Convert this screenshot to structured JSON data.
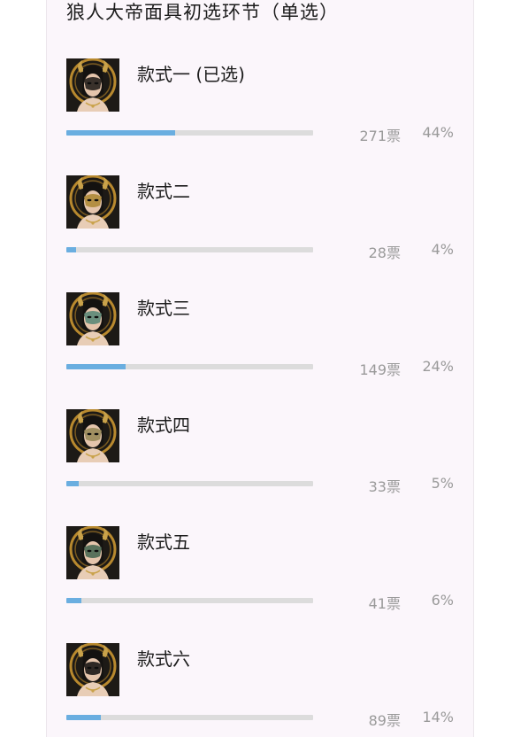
{
  "poll": {
    "title": "狼人大帝面具初选环节（单选）",
    "accent_color": "#6aaee0",
    "options": [
      {
        "label": "款式一 (已选)",
        "votes": "271票",
        "percent": "44%",
        "fill": 0.44,
        "mask_color": "#2a2420",
        "selected": true
      },
      {
        "label": "款式二",
        "votes": "28票",
        "percent": "4%",
        "fill": 0.04,
        "mask_color": "#b08a3a",
        "selected": false
      },
      {
        "label": "款式三",
        "votes": "149票",
        "percent": "24%",
        "fill": 0.24,
        "mask_color": "#5f8a78",
        "selected": false
      },
      {
        "label": "款式四",
        "votes": "33票",
        "percent": "5%",
        "fill": 0.05,
        "mask_color": "#9a8a5a",
        "selected": false
      },
      {
        "label": "款式五",
        "votes": "41票",
        "percent": "6%",
        "fill": 0.06,
        "mask_color": "#4e6a55",
        "selected": false
      },
      {
        "label": "款式六",
        "votes": "89票",
        "percent": "14%",
        "fill": 0.14,
        "mask_color": "#1e1a18",
        "selected": false
      }
    ]
  }
}
